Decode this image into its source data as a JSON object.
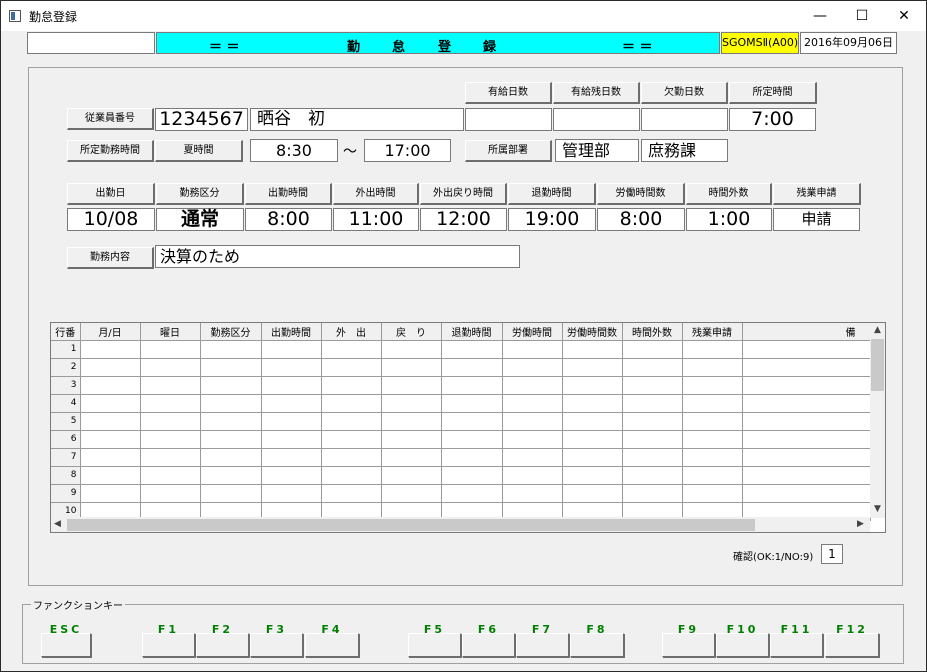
{
  "window": {
    "title": "勤怠登録",
    "minimize": "—",
    "maximize": "☐",
    "close": "✕"
  },
  "header": {
    "banner_left": "＝ ＝",
    "banner_chars": [
      "勤",
      "怠",
      "登",
      "録"
    ],
    "banner_right": "＝ ＝",
    "system": "SGOMSⅡ(A00)",
    "date": "2016年09月06日"
  },
  "employee": {
    "id_label": "従業員番号",
    "id": "1234567",
    "name": "晒谷　初",
    "shift_label": "所定勤務時間",
    "shift_type": "夏時間",
    "shift_start": "8:30",
    "tilde": "～",
    "shift_end": "17:00",
    "paid_days_label": "有給日数",
    "paid_days": "",
    "paid_remaining_label": "有給残日数",
    "paid_remaining": "",
    "absent_days_label": "欠勤日数",
    "absent_days": "",
    "scheduled_hours_label": "所定時間",
    "scheduled_hours": "7:00",
    "dept_label": "所属部署",
    "dept": "管理部",
    "section": "庶務課"
  },
  "entry": {
    "headers": [
      "出勤日",
      "勤務区分",
      "出勤時間",
      "外出時間",
      "外出戻り時間",
      "退勤時間",
      "労働時間数",
      "時間外数",
      "残業申請"
    ],
    "values": [
      "10/08",
      "通常",
      "8:00",
      "11:00",
      "12:00",
      "19:00",
      "8:00",
      "1:00",
      "申請"
    ],
    "content_label": "勤務内容",
    "content": "決算のため"
  },
  "grid": {
    "columns": [
      "行番",
      "月/日",
      "曜日",
      "勤務区分",
      "出勤時間",
      "外　出",
      "戻　り",
      "退勤時間",
      "労働時間",
      "労働時間数",
      "時間外数",
      "残業申請",
      "備"
    ],
    "rows": [
      "1",
      "2",
      "3",
      "4",
      "5",
      "6",
      "7",
      "8",
      "9",
      "10"
    ]
  },
  "confirm": {
    "label": "確認(OK:1/NO:9)",
    "value": "1"
  },
  "function_keys": {
    "group_label": "ファンクションキー",
    "keys": [
      "ESC",
      "F1",
      "F2",
      "F3",
      "F4",
      "F5",
      "F6",
      "F7",
      "F8",
      "F9",
      "F10",
      "F11",
      "F12"
    ]
  }
}
